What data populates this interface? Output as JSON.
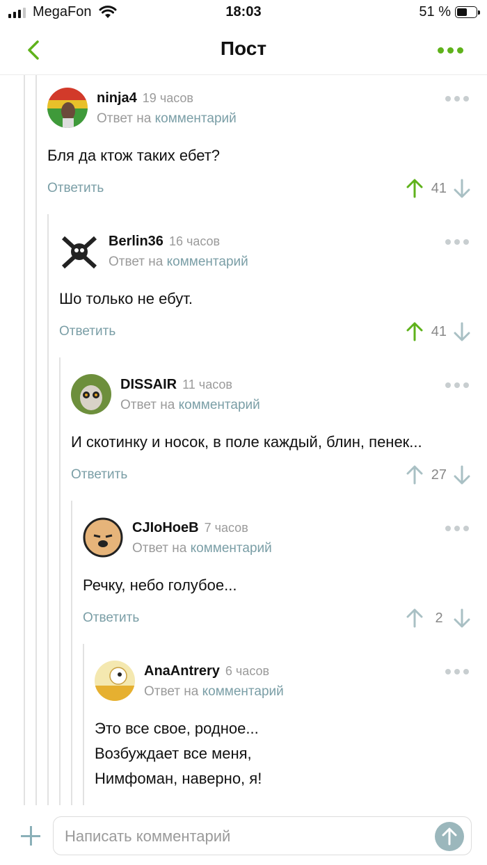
{
  "status_bar": {
    "carrier": "MegaFon",
    "time": "18:03",
    "battery": "51 %"
  },
  "nav": {
    "title": "Пост"
  },
  "comments": [
    {
      "author": "ninja4",
      "time": "19 часов",
      "reply_prefix": "Ответ на",
      "reply_link": "комментарий",
      "text": [
        "Бля да ктож таких ебет?"
      ],
      "reply_label": "Ответить",
      "votes": "41",
      "upvoted": true
    },
    {
      "author": "Berlin36",
      "time": "16 часов",
      "reply_prefix": "Ответ на",
      "reply_link": "комментарий",
      "text": [
        "Шо только не ебут."
      ],
      "reply_label": "Ответить",
      "votes": "41",
      "upvoted": true
    },
    {
      "author": "DISSAIR",
      "time": "11 часов",
      "reply_prefix": "Ответ на",
      "reply_link": "комментарий",
      "text": [
        "И скотинку и носок, в поле каждый, блин, пенек..."
      ],
      "reply_label": "Ответить",
      "votes": "27",
      "upvoted": false
    },
    {
      "author": "CJIoHoeB",
      "time": "7 часов",
      "reply_prefix": "Ответ на",
      "reply_link": "комментарий",
      "text": [
        "Речку, небо голубое..."
      ],
      "reply_label": "Ответить",
      "votes": "2",
      "upvoted": false
    },
    {
      "author": "AnaAntrery",
      "time": "6 часов",
      "reply_prefix": "Ответ на",
      "reply_link": "комментарий",
      "text": [
        "Это все свое, родное...",
        "Возбуждает все меня,",
        "Нимфоман, наверно, я!"
      ]
    }
  ],
  "composer": {
    "placeholder": "Написать комментарий"
  },
  "colors": {
    "accent_green": "#5fb21b",
    "link": "#7a9ea6",
    "vote_neutral": "#a9c0c4"
  },
  "icons": [
    "cellular-signal-icon",
    "wifi-icon",
    "battery-icon",
    "back-chevron-icon",
    "more-icon",
    "upvote-icon",
    "downvote-icon",
    "plus-icon",
    "send-icon"
  ]
}
